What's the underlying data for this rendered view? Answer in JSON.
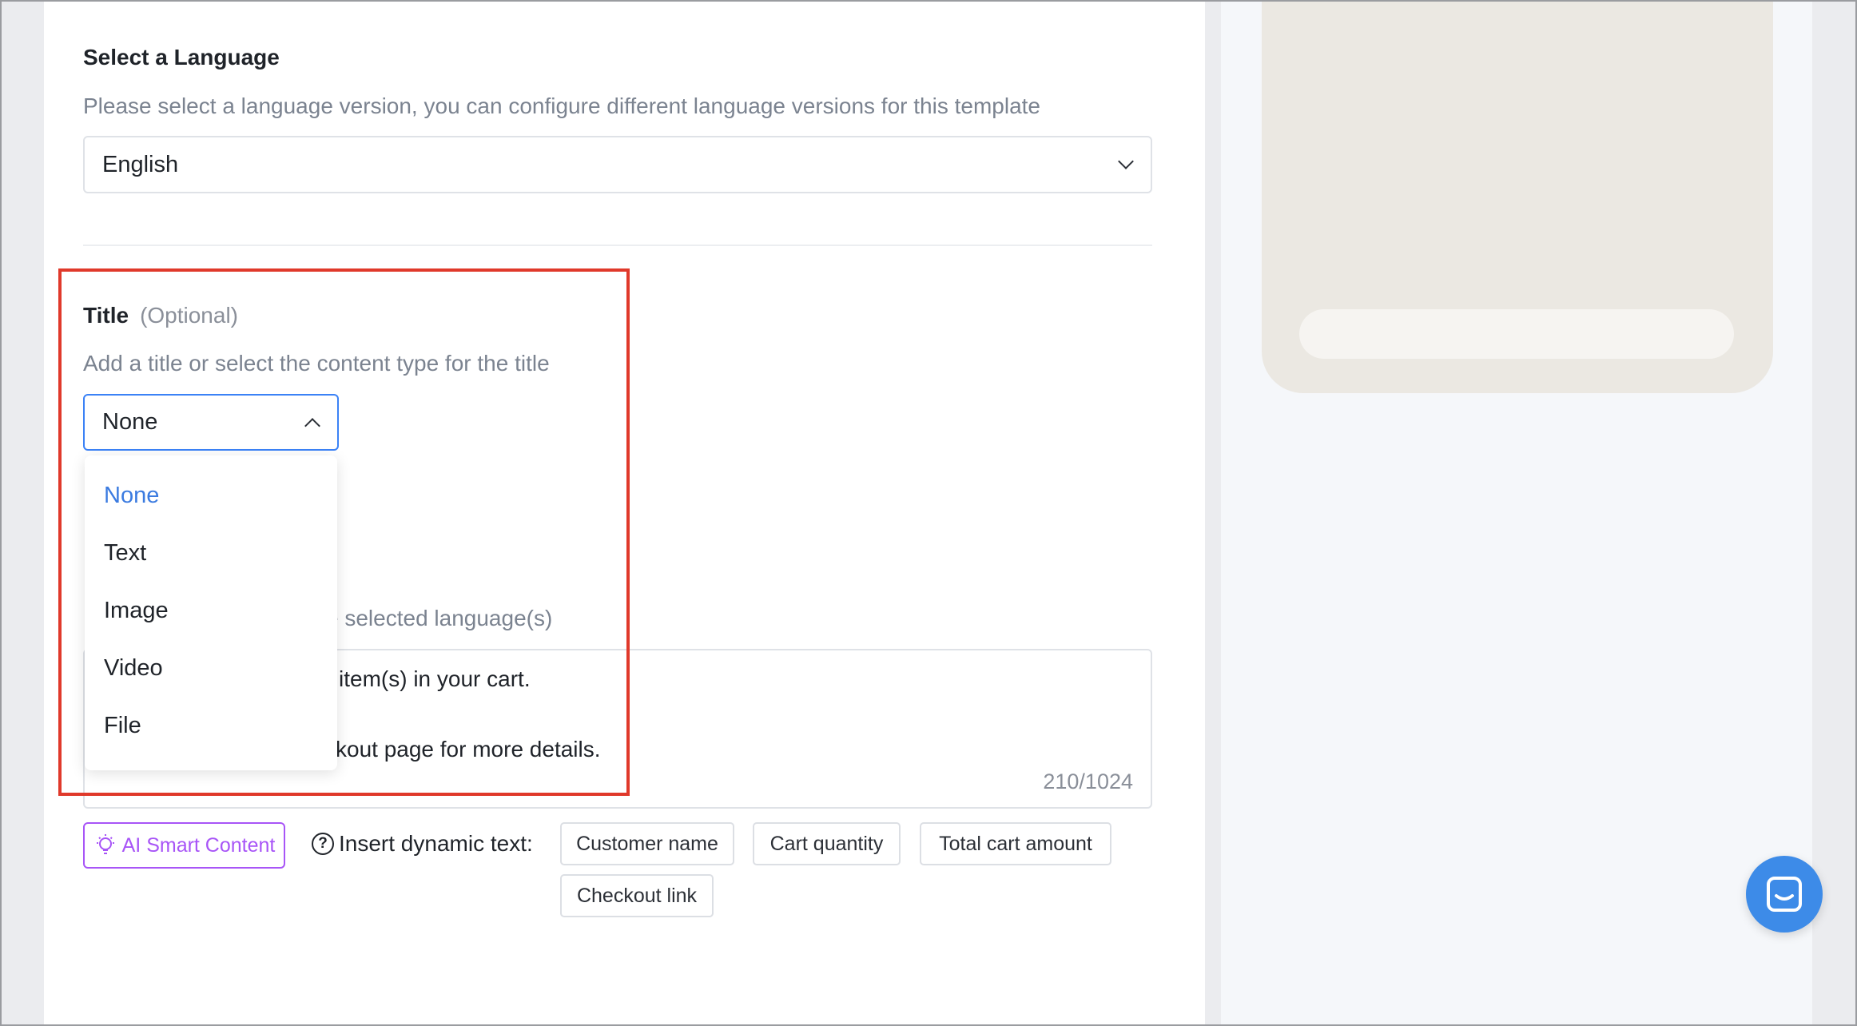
{
  "language_section": {
    "label": "Select a Language",
    "hint": "Please select a language version, you can configure different language versions for this template",
    "selected": "English"
  },
  "title_section": {
    "label": "Title",
    "optional": "(Optional)",
    "hint": "Add a title or select the content type for the title",
    "selected": "None",
    "options": [
      "None",
      "Text",
      "Image",
      "Video",
      "File"
    ]
  },
  "body_section": {
    "hint_partial": "e selected language(s)",
    "line1_partial": "item(s) in your cart.",
    "line2_partial": "kout page for more details.",
    "counter": "210/1024"
  },
  "actions": {
    "ai_label": "AI Smart Content",
    "insert_label": "Insert dynamic text:",
    "chips": [
      "Customer name",
      "Cart quantity",
      "Total cart amount",
      "Checkout link"
    ]
  },
  "colors": {
    "accent": "#3b82f6",
    "ai": "#a855f7",
    "highlight": "#e0392b",
    "chat": "#3d8be8"
  }
}
